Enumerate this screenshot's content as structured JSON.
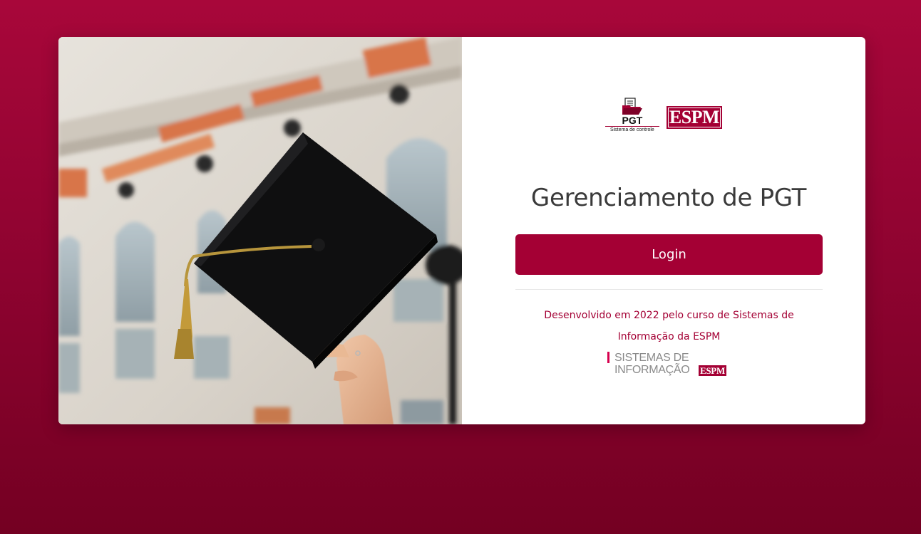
{
  "hero": {
    "image_alt": "graduation cap raised in front of a building",
    "icon": "graduation-cap-photo"
  },
  "logos": {
    "pgt_title": "PGT",
    "pgt_subtitle": "Sistema de controle",
    "espm": "ESPM"
  },
  "main": {
    "title": "Gerenciamento de PGT",
    "login_label": "Login"
  },
  "footer": {
    "line": "Desenvolvido em 2022 pelo curso de Sistemas de Informação da ESPM",
    "si_logo_line1": "SISTEMAS DE",
    "si_logo_line2": "INFORMAÇÃO",
    "si_logo_brand": "ESPM"
  },
  "colors": {
    "brand": "#a40034",
    "background_top": "#a8073a",
    "background_bottom": "#740022"
  }
}
